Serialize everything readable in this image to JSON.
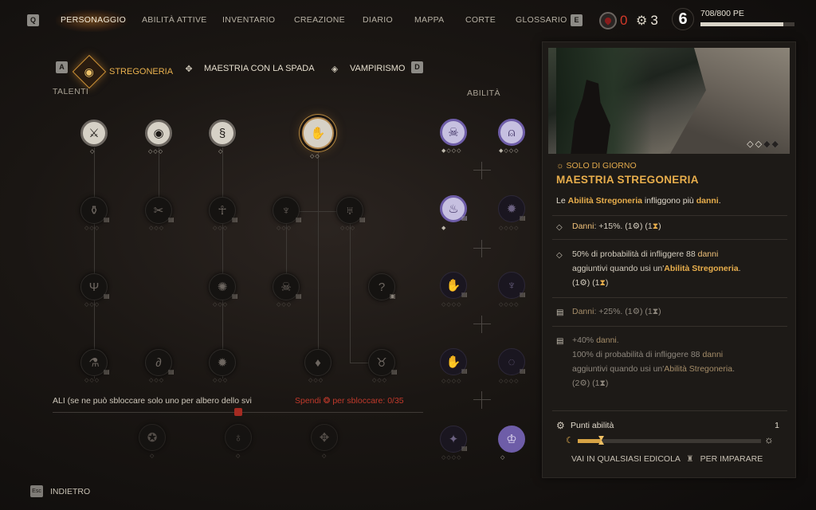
{
  "topbar": {
    "key_left": "Q",
    "key_right": "E",
    "nav": [
      "PERSONAGGIO",
      "ABILITÀ ATTIVE",
      "INVENTARIO",
      "CREAZIONE",
      "DIARIO",
      "MAPPA",
      "CORTE",
      "GLOSSARIO"
    ],
    "active_index": 0,
    "blood_count": "0",
    "gear_count": "3",
    "level": "6",
    "xp_text": "708/800 PE",
    "xp_fraction": 0.885
  },
  "trees": {
    "key_left": "A",
    "key_right": "D",
    "tabs": [
      "STREGONERIA",
      "MAESTRIA CON LA SPADA",
      "VAMPIRISMO"
    ],
    "active": 0,
    "talents_label": "TALENTI",
    "abilities_label": "ABILITÀ"
  },
  "bottom": {
    "note": "ALI (se ne può sbloccare solo uno per albero dello svi",
    "spend_prefix": "Spendi",
    "spend_suffix": "per sbloccare: 0/35"
  },
  "footer": {
    "esc_key": "Esc",
    "back_label": "INDIETRO"
  },
  "panel": {
    "image_diamonds": [
      "◇",
      "◇",
      "◆",
      "◆"
    ],
    "day_label": "SOLO DI GIORNO",
    "title": "MAESTRIA STREGONERIA",
    "desc_prefix": "Le ",
    "desc_highlight": "Abilità Stregoneria",
    "desc_mid": " infliggono più ",
    "desc_dmg": "danni",
    "desc_end": ".",
    "row1": {
      "dmg": "Danni",
      "text": ": +15%.  (1",
      "close": ")  (1",
      "end": ")"
    },
    "row2": {
      "line1_a": "50% di probabilità di infliggere 88 ",
      "line1_b": "danni",
      "line2_a": "aggiuntivi quando usi un'",
      "line2_b": "Abilità Stregoneria",
      "line2_c": ".",
      "line3_a": "(1",
      "line3_b": ")  (1",
      "line3_c": ")"
    },
    "row3": {
      "dmg": "Danni",
      "text": ": +25%.  (1",
      "close": ")  (1",
      "end": ")"
    },
    "row4": {
      "line1_a": "+40% ",
      "line1_b": "danni",
      "line1_c": ".",
      "line2_a": "100% di probabilità di infliggere 88 ",
      "line2_b": "danni",
      "line3_a": "aggiuntivi quando usi un'",
      "line3_b": "Abilità Stregoneria",
      "line3_c": ".",
      "line4_a": "(2",
      "line4_b": ")  (1",
      "line4_c": ")"
    },
    "points_label": "Punti abilità",
    "points_value": "1",
    "progress_fraction": 0.13,
    "learn_prefix": "VAI IN QUALSIASI EDICOLA",
    "learn_suffix": "PER IMPARARE"
  },
  "colors": {
    "accent": "#e8ae4c",
    "warning": "#c0392b",
    "purple": "#6e5da8"
  }
}
